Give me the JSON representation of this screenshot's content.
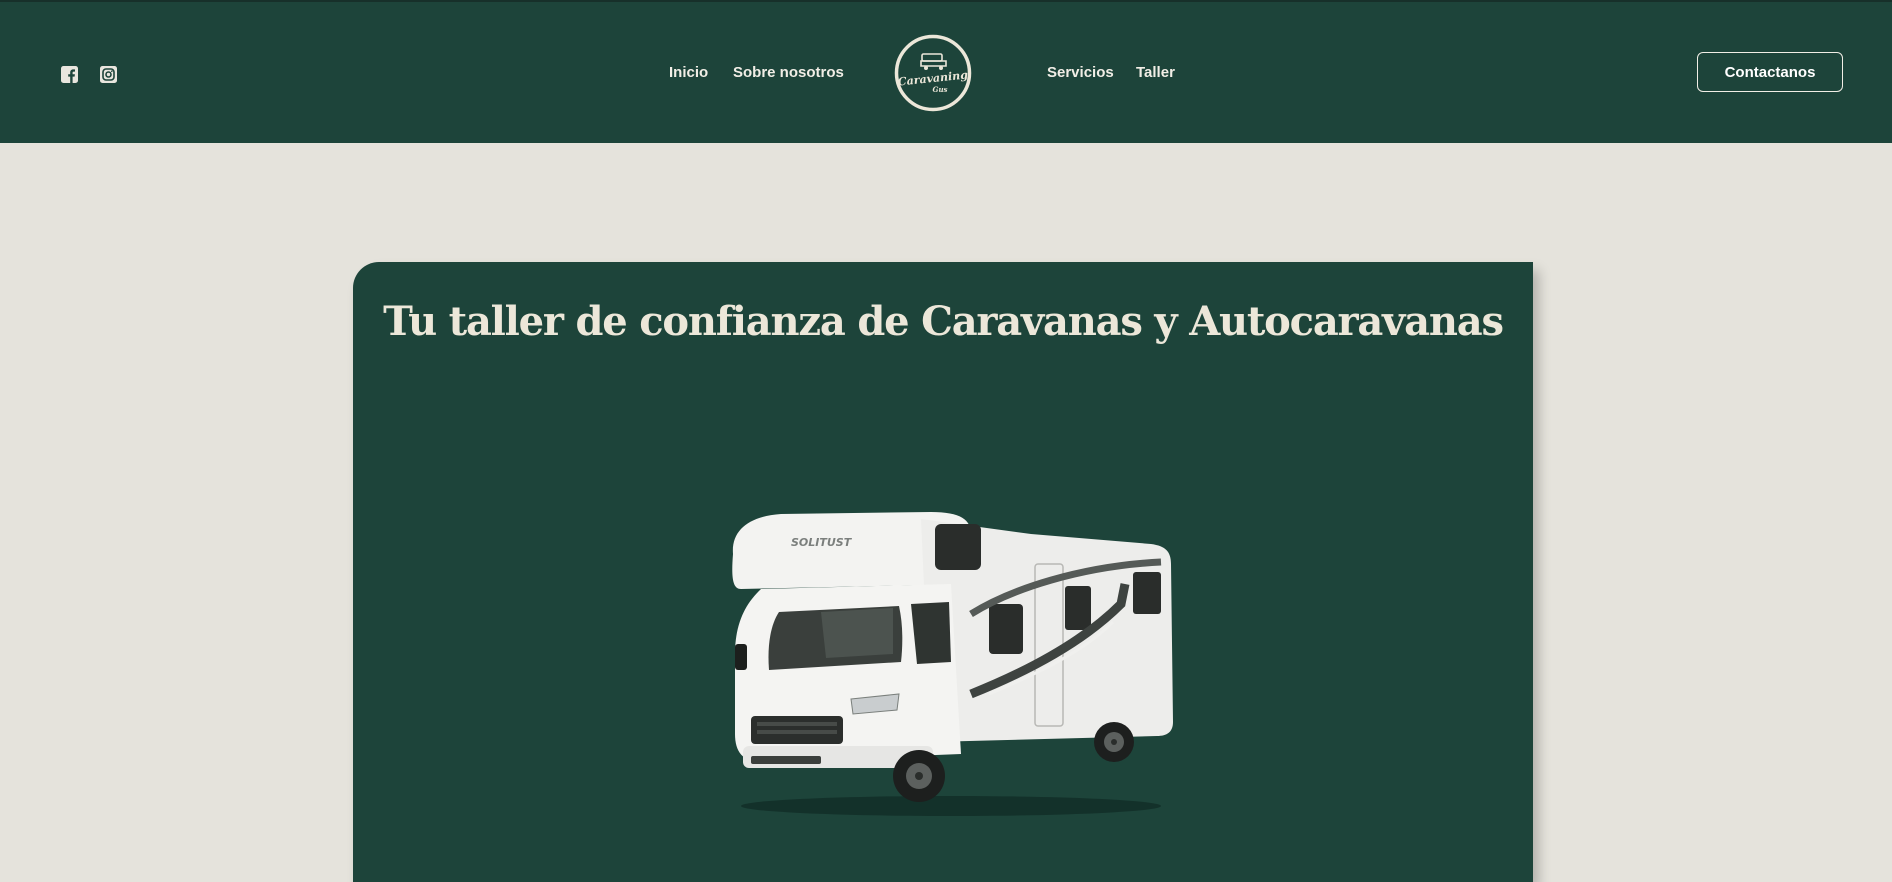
{
  "header": {
    "social": [
      {
        "name": "facebook",
        "icon": "facebook-icon"
      },
      {
        "name": "instagram",
        "icon": "instagram-icon"
      }
    ],
    "nav_left": [
      {
        "label": "Inicio"
      },
      {
        "label": "Sobre nosotros"
      }
    ],
    "nav_right": [
      {
        "label": "Servicios"
      },
      {
        "label": "Taller"
      }
    ],
    "logo": {
      "text": "Caravaning",
      "subtext": "Gus"
    },
    "cta_label": "Contactanos"
  },
  "hero": {
    "title": "Tu taller de confianza de Caravanas y Autocaravanas",
    "image_icon": "motorhome-image",
    "van_brand": "SOLITUST"
  },
  "colors": {
    "primary_green": "#1d443a",
    "background": "#e5e3dc",
    "light_text": "#ece7d9"
  }
}
